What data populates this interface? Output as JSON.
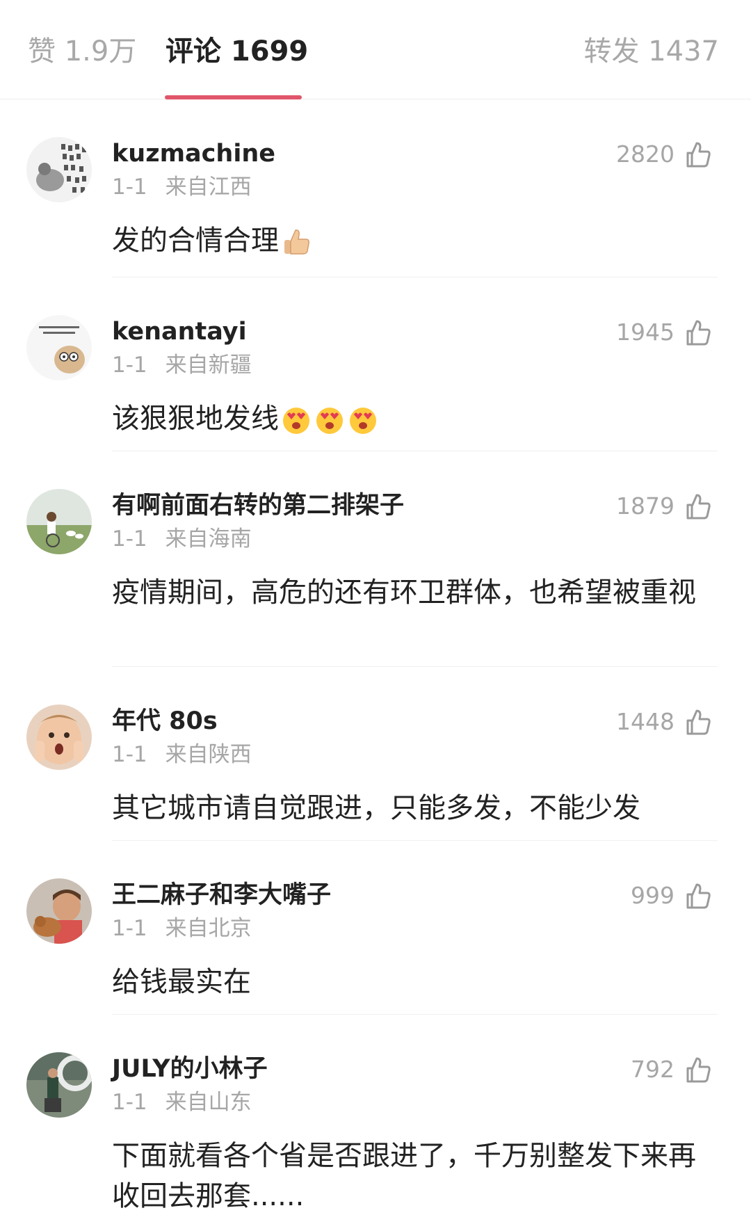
{
  "tabs": {
    "likes": "赞 1.9万",
    "comments": "评论 1699",
    "reposts": "转发 1437",
    "active": "comments",
    "accent_color": "#e0566a"
  },
  "comments": [
    {
      "username": "kuzmachine",
      "date": "1-1",
      "location": "来自江西",
      "likes": "2820",
      "text": "发的合情合理",
      "emojis": [
        "thumbs-up"
      ]
    },
    {
      "username": "kenantayi",
      "date": "1-1",
      "location": "来自新疆",
      "likes": "1945",
      "text": "该狠狠地发线",
      "emojis": [
        "heart-eyes",
        "heart-eyes",
        "heart-eyes"
      ]
    },
    {
      "username": "有啊前面右转的第二排架子",
      "date": "1-1",
      "location": "来自海南",
      "likes": "1879",
      "text": "疫情期间，高危的还有环卫群体，也希望被重视",
      "emojis": []
    },
    {
      "username": "年代 80s",
      "date": "1-1",
      "location": "来自陕西",
      "likes": "1448",
      "text": "其它城市请自觉跟进，只能多发，不能少发",
      "emojis": []
    },
    {
      "username": "王二麻子和李大嘴子",
      "date": "1-1",
      "location": "来自北京",
      "likes": "999",
      "text": "给钱最实在",
      "emojis": []
    },
    {
      "username": "JULY的小林子",
      "date": "1-1",
      "location": "来自山东",
      "likes": "792",
      "text": "下面就看各个省是否跟进了，千万别整发下来再收回去那套......",
      "emojis": []
    }
  ]
}
